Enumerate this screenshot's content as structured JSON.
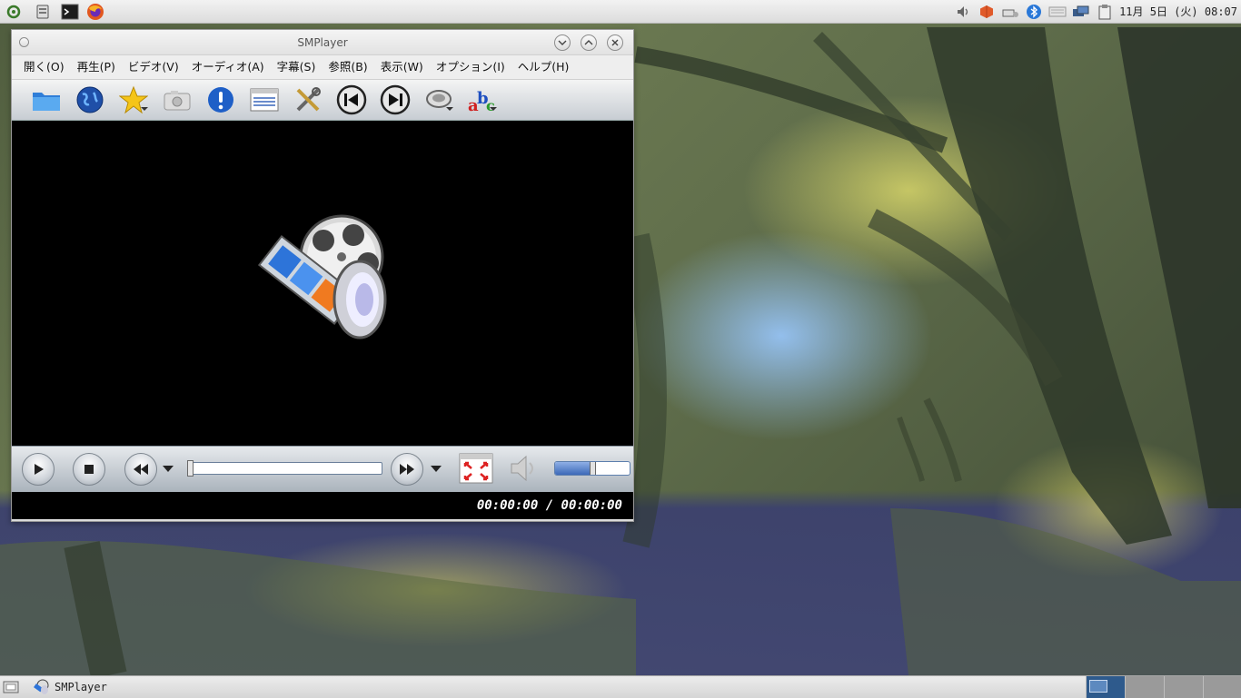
{
  "window": {
    "title": "SMPlayer"
  },
  "menubar": {
    "items": [
      "開く(O)",
      "再生(P)",
      "ビデオ(V)",
      "オーディオ(A)",
      "字幕(S)",
      "参照(B)",
      "表示(W)",
      "オプション(I)",
      "ヘルプ(H)"
    ]
  },
  "toolbar": {
    "icons": [
      "open-folder-icon",
      "globe-icon",
      "favorites-star-icon",
      "screenshot-camera-icon",
      "info-icon",
      "playlist-icon",
      "preferences-tools-icon",
      "previous-icon",
      "next-icon",
      "audio-track-icon",
      "subtitle-abc-icon"
    ]
  },
  "player": {
    "time_display": "00:00:00 / 00:00:00",
    "seek_progress": 0,
    "volume_level": 0.5
  },
  "top_panel": {
    "clock": "11月 5日 (火) 08:07"
  },
  "taskbar": {
    "task_label": "SMPlayer"
  }
}
